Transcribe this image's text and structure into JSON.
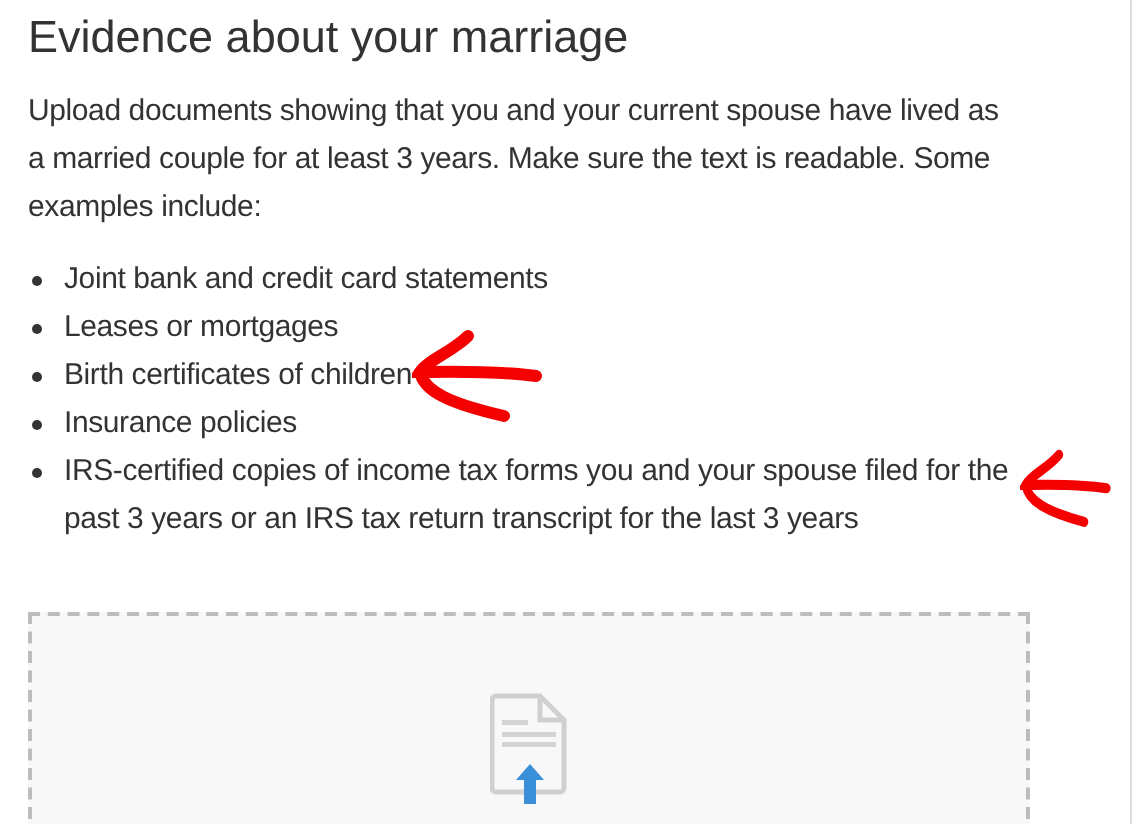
{
  "heading": "Evidence about your marriage",
  "intro": "Upload documents showing that you and your current spouse have lived as a married couple for at least 3 years. Make sure the text is readable. Some examples include:",
  "examples": [
    {
      "text": "Joint bank and credit card statements",
      "marked": false
    },
    {
      "text": "Leases or mortgages",
      "marked": false
    },
    {
      "text": "Birth certificates of children",
      "marked": true
    },
    {
      "text": "Insurance policies",
      "marked": false
    },
    {
      "text": "IRS-certified copies of income tax forms you and your spouse filed for the past 3 years or an IRS tax return transcript for the last 3 years",
      "marked": true
    }
  ],
  "upload_area": {
    "kind": "dropzone"
  }
}
